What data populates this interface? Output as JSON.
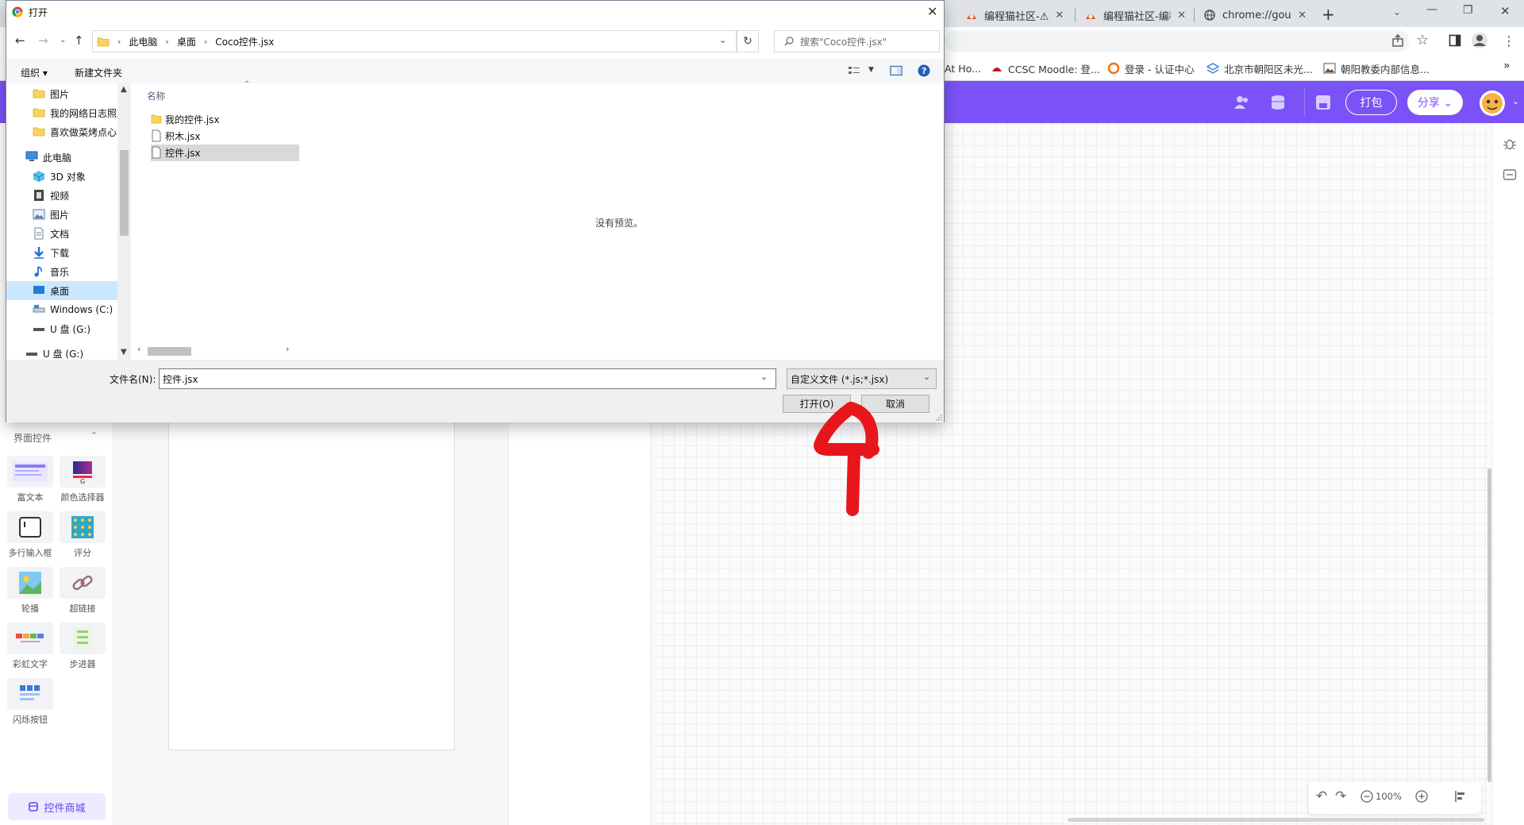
{
  "browser": {
    "tabs": [
      {
        "title": "编程猫社区-⚠"
      },
      {
        "title": "编程猫社区-编程"
      },
      {
        "title": "chrome://gou/"
      }
    ],
    "new_tab_label": "+",
    "bookmarks": [
      {
        "label": "At Ho..."
      },
      {
        "label": "CCSC Moodle: 登..."
      },
      {
        "label": "登录 - 认证中心"
      },
      {
        "label": "北京市朝阳区未光..."
      },
      {
        "label": "朝阳教委内部信息..."
      }
    ],
    "bookmarks_overflow": "»"
  },
  "app": {
    "header": {
      "pack_label": "打包",
      "share_label": "分享 ⌄"
    },
    "colors": {
      "brand": "#7b52f7",
      "annotation": "#e8161a"
    },
    "left_panel": {
      "section_title": "界面控件",
      "widgets": [
        {
          "label": "富文本"
        },
        {
          "label": "颜色选择器"
        },
        {
          "label": "多行输入框"
        },
        {
          "label": "评分"
        },
        {
          "label": "轮播"
        },
        {
          "label": "超链接"
        },
        {
          "label": "彩虹文字"
        },
        {
          "label": "步进器"
        },
        {
          "label": "闪烁按钮"
        }
      ],
      "store_label": "控件商城"
    },
    "bottom_tools": {
      "zoom_label": "100%"
    }
  },
  "dialog": {
    "title": "打开",
    "breadcrumb": [
      "此电脑",
      "桌面",
      "Coco控件.jsx"
    ],
    "search_placeholder": "搜索\"Coco控件.jsx\"",
    "organize_label": "组织 ▾",
    "new_folder_label": "新建文件夹",
    "tree_items": [
      {
        "label": "图片",
        "icon": "folder-icon"
      },
      {
        "label": "我的网络日志照片",
        "icon": "folder-icon"
      },
      {
        "label": "喜欢做菜烤点心",
        "icon": "folder-icon"
      },
      {
        "label": "此电脑",
        "icon": "computer-icon"
      },
      {
        "label": "3D 对象",
        "icon": "cube-icon"
      },
      {
        "label": "视频",
        "icon": "video-icon"
      },
      {
        "label": "图片",
        "icon": "picture-icon"
      },
      {
        "label": "文档",
        "icon": "document-icon"
      },
      {
        "label": "下载",
        "icon": "download-icon"
      },
      {
        "label": "音乐",
        "icon": "music-icon"
      },
      {
        "label": "桌面",
        "icon": "desktop-icon"
      },
      {
        "label": "Windows (C:)",
        "icon": "drive-icon"
      },
      {
        "label": "U 盘 (G:)",
        "icon": "usb-drive-icon"
      },
      {
        "label": "U 盘 (G:)",
        "icon": "usb-drive-icon"
      }
    ],
    "column_header": "名称",
    "files": [
      {
        "name": "我的控件.jsx",
        "icon": "folder-icon"
      },
      {
        "name": "积木.jsx",
        "icon": "file-icon"
      },
      {
        "name": "控件.jsx",
        "icon": "file-icon",
        "selected": true
      }
    ],
    "preview_text": "没有预览。",
    "filename_label": "文件名(N):",
    "filename_value": "控件.jsx",
    "filetype_value": "自定义文件 (*.js;*.jsx)",
    "open_label": "打开(O)",
    "cancel_label": "取消"
  }
}
